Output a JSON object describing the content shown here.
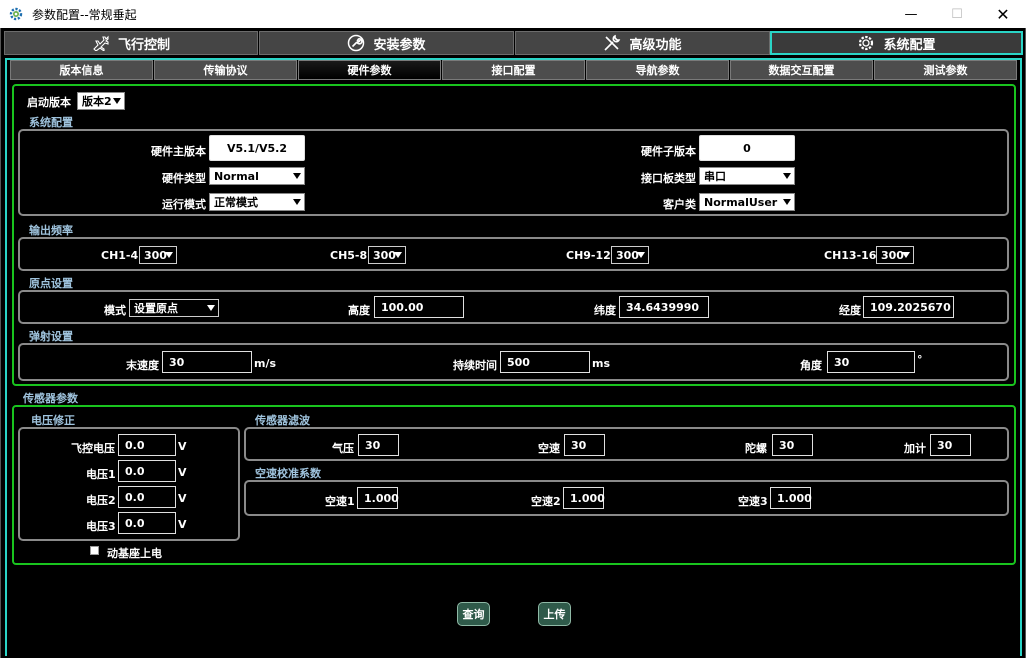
{
  "window": {
    "title": "参数配置--常规垂起",
    "minimize": "—",
    "maximize": "☐",
    "close": "✕"
  },
  "top_tabs": [
    {
      "label": "飞行控制",
      "icon": "airplane-icon"
    },
    {
      "label": "安装参数",
      "icon": "wrench-circle-icon"
    },
    {
      "label": "高级功能",
      "icon": "tools-icon"
    },
    {
      "label": "系统配置",
      "icon": "gear-icon",
      "active": true
    }
  ],
  "sub_tabs": [
    "版本信息",
    "传输协议",
    "硬件参数",
    "接口配置",
    "导航参数",
    "数据交互配置",
    "测试参数"
  ],
  "active_sub_tab": "硬件参数",
  "boot": {
    "label": "启动版本",
    "value": "版本2"
  },
  "system_config": {
    "section": "系统配置",
    "hw_main_label": "硬件主版本",
    "hw_main_value": "V5.1/V5.2",
    "hw_sub_label": "硬件子版本",
    "hw_sub_value": "0",
    "hw_type_label": "硬件类型",
    "hw_type_value": "Normal",
    "iface_board_label": "接口板类型",
    "iface_board_value": "串口",
    "run_mode_label": "运行模式",
    "run_mode_value": "正常模式",
    "customer_label": "客户类",
    "customer_value": "NormalUser"
  },
  "output_freq": {
    "section": "输出频率",
    "channels": [
      {
        "label": "CH1-4",
        "value": "300"
      },
      {
        "label": "CH5-8",
        "value": "300"
      },
      {
        "label": "CH9-12",
        "value": "300"
      },
      {
        "label": "CH13-16",
        "value": "300"
      }
    ]
  },
  "origin": {
    "section": "原点设置",
    "mode_label": "模式",
    "mode_value": "设置原点",
    "alt_label": "高度",
    "alt_value": "100.00",
    "lat_label": "纬度",
    "lat_value": "34.6439990",
    "lon_label": "经度",
    "lon_value": "109.2025670"
  },
  "launch": {
    "section": "弹射设置",
    "speed_label": "末速度",
    "speed_value": "30",
    "speed_unit": "m/s",
    "duration_label": "持续时间",
    "duration_value": "500",
    "duration_unit": "ms",
    "angle_label": "角度",
    "angle_value": "30",
    "angle_unit": "°"
  },
  "sensor": {
    "section": "传感器参数",
    "voltage_section": "电压修正",
    "voltages": [
      {
        "label": "飞控电压",
        "value": "0.0",
        "unit": "V"
      },
      {
        "label": "电压1",
        "value": "0.0",
        "unit": "V"
      },
      {
        "label": "电压2",
        "value": "0.0",
        "unit": "V"
      },
      {
        "label": "电压3",
        "value": "0.0",
        "unit": "V"
      }
    ],
    "filter_section": "传感器滤波",
    "filters": [
      {
        "label": "气压",
        "value": "30"
      },
      {
        "label": "空速",
        "value": "30"
      },
      {
        "label": "陀螺",
        "value": "30"
      },
      {
        "label": "加计",
        "value": "30"
      }
    ],
    "airspeed_section": "空速校准系数",
    "airspeeds": [
      {
        "label": "空速1",
        "value": "1.000"
      },
      {
        "label": "空速2",
        "value": "1.000"
      },
      {
        "label": "空速3",
        "value": "1.000"
      }
    ],
    "base_power_label": "动基座上电"
  },
  "buttons": {
    "query": "查询",
    "upload": "上传"
  }
}
